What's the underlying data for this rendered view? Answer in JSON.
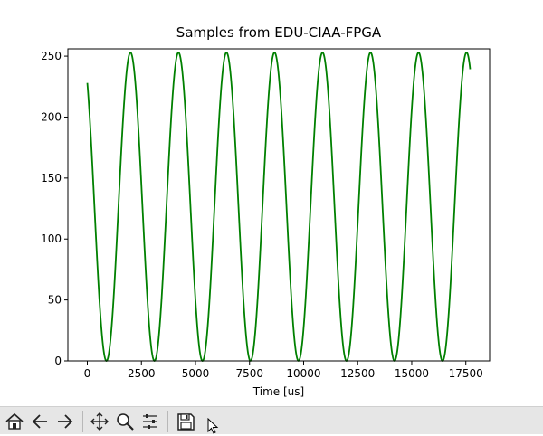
{
  "window": {
    "figure_title": "Samples from EDU-CIAA-FPGA"
  },
  "chart_data": {
    "type": "line",
    "title": "Samples from EDU-CIAA-FPGA",
    "xlabel": "Time [us]",
    "ylabel": "",
    "xlim": [
      -900,
      18600
    ],
    "ylim": [
      0,
      256
    ],
    "xticks": [
      0,
      2500,
      5000,
      7500,
      10000,
      12500,
      15000,
      17500
    ],
    "xtick_labels": [
      "0",
      "2500",
      "5000",
      "7500",
      "10000",
      "12500",
      "15000",
      "17500"
    ],
    "yticks": [
      0,
      50,
      100,
      150,
      200,
      250
    ],
    "ytick_labels": [
      "0",
      "50",
      "100",
      "150",
      "200",
      "250"
    ],
    "grid": false,
    "legend": "none",
    "series": [
      {
        "color": "#008000",
        "function": "sine",
        "amplitude": 126.5,
        "offset": 126.5,
        "period_us": 2220,
        "x_start": 0,
        "x_end": 17700,
        "y_start": 228,
        "y_end": 229,
        "min_value": 0,
        "max_value": 253
      }
    ]
  },
  "toolbar": {
    "buttons": [
      {
        "name": "home-button",
        "icon": "home-icon"
      },
      {
        "name": "back-button",
        "icon": "arrow-left-icon"
      },
      {
        "name": "forward-button",
        "icon": "arrow-right-icon"
      },
      {
        "name": "pan-button",
        "icon": "move-icon"
      },
      {
        "name": "zoom-button",
        "icon": "magnifier-icon"
      },
      {
        "name": "configure-subplots-button",
        "icon": "sliders-icon"
      },
      {
        "name": "save-button",
        "icon": "floppy-disk-icon"
      }
    ]
  }
}
